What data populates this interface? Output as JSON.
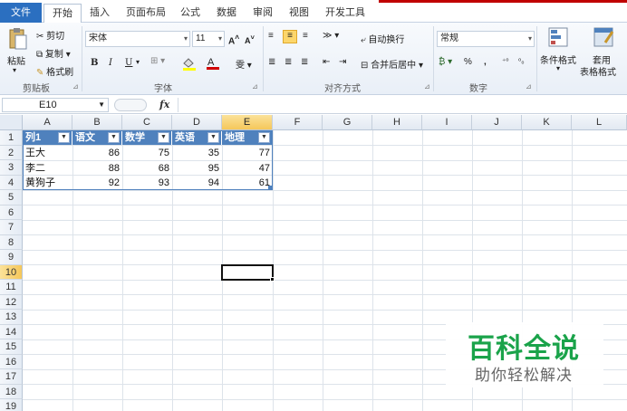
{
  "tabs": [
    "文件",
    "开始",
    "插入",
    "页面布局",
    "公式",
    "数据",
    "审阅",
    "视图",
    "开发工具"
  ],
  "ribbon": {
    "clipboard": {
      "paste": "粘贴",
      "cut": "剪切",
      "copy": "复制",
      "format_painter": "格式刷",
      "label": "剪贴板"
    },
    "font": {
      "name": "宋体",
      "size": "11",
      "bold": "B",
      "italic": "I",
      "underline": "U",
      "grow": "A",
      "shrink": "A",
      "label": "字体"
    },
    "alignment": {
      "wrap": "自动换行",
      "merge": "合并后居中",
      "label": "对齐方式"
    },
    "number": {
      "format": "常规",
      "percent": "%",
      "comma": ",",
      "label": "数字"
    },
    "styles": {
      "conditional": "条件格式",
      "table_format_1": "套用",
      "table_format_2": "表格格式"
    }
  },
  "formula_bar": {
    "name_box": "E10",
    "fx": "fx",
    "value": ""
  },
  "grid": {
    "columns": [
      "A",
      "B",
      "C",
      "D",
      "E",
      "F",
      "G",
      "H",
      "I",
      "J",
      "K",
      "L"
    ],
    "selected_column": "E",
    "rows": [
      "1",
      "2",
      "3",
      "4",
      "5",
      "6",
      "7",
      "8",
      "9",
      "10",
      "11",
      "12",
      "13",
      "14",
      "15",
      "16",
      "17",
      "18",
      "19"
    ],
    "selected_row": "10",
    "table": {
      "headers": [
        "列1",
        "语文",
        "数学",
        "英语",
        "地理"
      ],
      "data": [
        [
          "王大",
          "86",
          "75",
          "35",
          "77"
        ],
        [
          "李二",
          "88",
          "68",
          "95",
          "47"
        ],
        [
          "黄狗子",
          "92",
          "93",
          "94",
          "61"
        ]
      ],
      "header_color": "#4f81bd"
    }
  },
  "watermark": {
    "title": "百科全说",
    "subtitle": "助你轻松解决",
    "color": "#1aa34a"
  }
}
